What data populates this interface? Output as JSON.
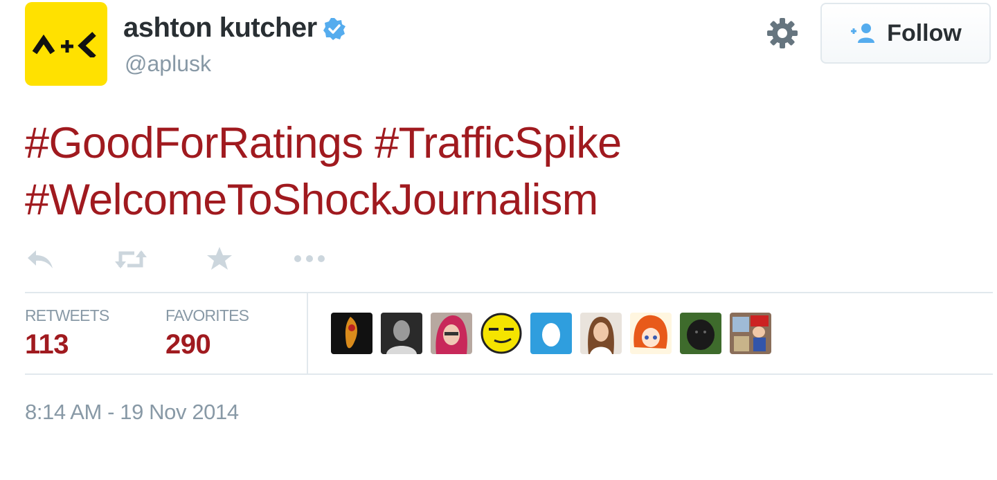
{
  "user": {
    "name": "ashton kutcher",
    "handle": "@aplusk",
    "avatar_logo": "A+K"
  },
  "follow_button": {
    "label": "Follow",
    "icon": "add-user-icon"
  },
  "tweet": {
    "hashtags": [
      "#GoodForRatings",
      "#TrafficSpike",
      "#WelcomeToShockJournalism"
    ]
  },
  "actions": [
    {
      "name": "reply",
      "icon": "reply-icon"
    },
    {
      "name": "retweet",
      "icon": "retweet-icon"
    },
    {
      "name": "favorite",
      "icon": "star-icon"
    },
    {
      "name": "more",
      "icon": "more-icon"
    }
  ],
  "stats": {
    "retweets": {
      "label": "RETWEETS",
      "value": "113"
    },
    "favorites": {
      "label": "FAVORITES",
      "value": "290"
    }
  },
  "favorited_by_count_shown": 9,
  "timestamp": "8:14 AM - 19 Nov 2014",
  "colors": {
    "hashtag": "#a01a1f",
    "verified": "#55acee",
    "follow_icon": "#55acee",
    "muted": "#8899a6",
    "avatar_bg": "#ffe100"
  }
}
